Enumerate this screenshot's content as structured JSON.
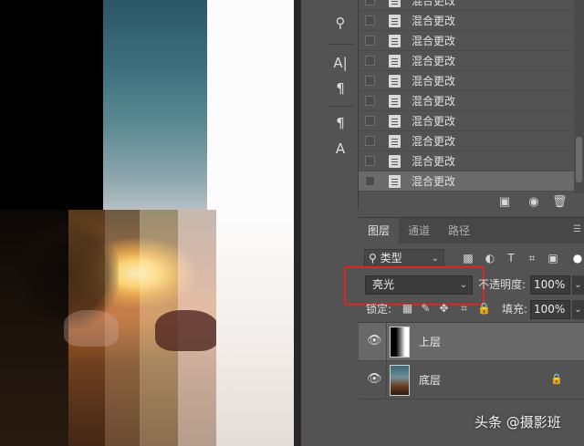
{
  "history": {
    "items": [
      {
        "label": "混合更改",
        "active": false
      },
      {
        "label": "混合更改",
        "active": false
      },
      {
        "label": "混合更改",
        "active": false
      },
      {
        "label": "混合更改",
        "active": false
      },
      {
        "label": "混合更改",
        "active": false
      },
      {
        "label": "混合更改",
        "active": false
      },
      {
        "label": "混合更改",
        "active": false
      },
      {
        "label": "混合更改",
        "active": false
      },
      {
        "label": "混合更改",
        "active": false
      },
      {
        "label": "混合更改",
        "active": true
      }
    ],
    "bottom_buttons": [
      "new-document-from-state-icon",
      "camera-icon",
      "trash-icon"
    ]
  },
  "tools": {
    "icons": [
      "layer-comp-icon",
      "character-icon",
      "paragraph-icon",
      "paragraph-style-icon",
      "character-style-icon"
    ],
    "glyphs": [
      "⚲",
      "A|",
      "¶",
      "¶",
      "A"
    ]
  },
  "layers_panel": {
    "tabs": [
      {
        "label": "图层",
        "active": true
      },
      {
        "label": "通道",
        "active": false
      },
      {
        "label": "路径",
        "active": false
      }
    ],
    "filter": {
      "label": "类型",
      "icon": "search-icon"
    },
    "filter_icons": [
      "image-filter-icon",
      "adjustment-filter-icon",
      "type-filter-icon",
      "shape-filter-icon",
      "smart-object-filter-icon"
    ],
    "blend_mode": "亮光",
    "opacity_label": "不透明度:",
    "opacity_value": "100%",
    "lock_label": "锁定:",
    "lock_icons": [
      "lock-transparent-icon",
      "lock-image-icon",
      "lock-position-icon",
      "lock-artboard-icon",
      "lock-all-icon"
    ],
    "fill_label": "填充:",
    "fill_value": "100%",
    "layers": [
      {
        "name": "上层",
        "selected": true,
        "locked": false
      },
      {
        "name": "底层",
        "selected": false,
        "locked": true
      }
    ]
  },
  "watermark": "头条 @摄影班",
  "colors": {
    "panel_bg": "#535353",
    "highlight_box": "#e0251e",
    "selected_row": "#686868"
  }
}
